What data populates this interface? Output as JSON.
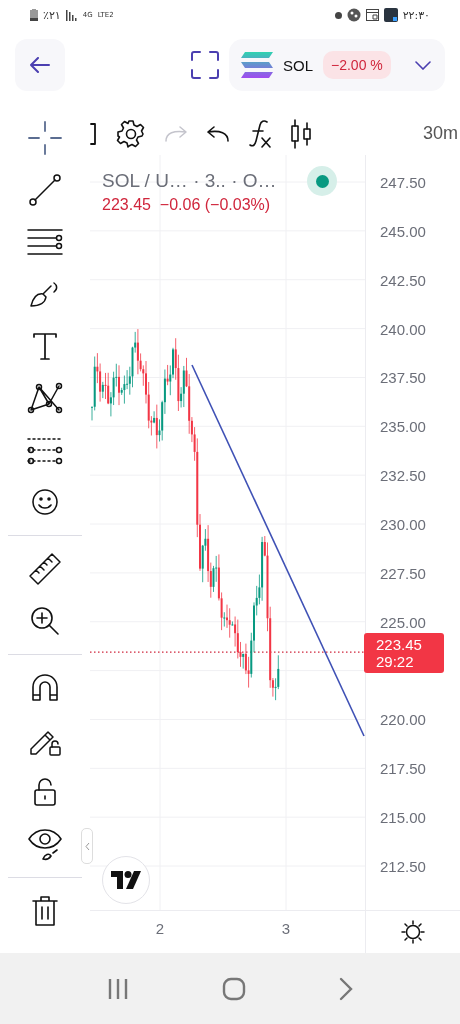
{
  "status_bar": {
    "battery": "٪۲۱",
    "network": "4G",
    "volte": "LTE2",
    "time": "۲۲:۳۰"
  },
  "header": {
    "symbol": "SOL",
    "change": "−2.00 %"
  },
  "toolbar": {
    "items": [
      {
        "kind": "bracket",
        "disabled": false
      },
      {
        "kind": "settings",
        "disabled": false
      },
      {
        "kind": "redo",
        "disabled": true
      },
      {
        "kind": "undo",
        "disabled": false
      },
      {
        "kind": "indicators",
        "disabled": false
      },
      {
        "kind": "chart-type",
        "disabled": false
      }
    ],
    "timeframe": "30m"
  },
  "tool_groups": [
    [
      {
        "kind": "crosshair",
        "selected": true
      },
      {
        "kind": "trend-line",
        "selected": false
      },
      {
        "kind": "horizontal-lines",
        "selected": false
      },
      {
        "kind": "brush",
        "selected": false
      },
      {
        "kind": "text",
        "selected": false
      },
      {
        "kind": "pattern",
        "selected": false
      },
      {
        "kind": "fib",
        "selected": false
      },
      {
        "kind": "emoji",
        "selected": false
      }
    ],
    [
      {
        "kind": "ruler",
        "selected": false
      },
      {
        "kind": "zoom",
        "selected": false
      }
    ],
    [
      {
        "kind": "magnet",
        "selected": false
      },
      {
        "kind": "lock-drawing",
        "selected": false
      },
      {
        "kind": "lock",
        "selected": false
      },
      {
        "kind": "eye",
        "selected": false
      }
    ],
    [
      {
        "kind": "trash",
        "selected": false
      }
    ]
  ],
  "legend": {
    "title": "SOL / U… · 3.. · O…",
    "quote": "223.45  −0.06 (−0.03%)"
  },
  "price_axis_upper": [
    "247.50",
    "245.00",
    "242.50",
    "240.00",
    "237.50",
    "235.00",
    "232.50",
    "230.00",
    "227.50",
    "225.00"
  ],
  "price_axis_lower": [
    "220.00",
    "217.50",
    "215.00",
    "212.50"
  ],
  "current_price": {
    "price": "223.45",
    "countdown": "29:22"
  },
  "time_axis": [
    "2",
    "3"
  ]
}
